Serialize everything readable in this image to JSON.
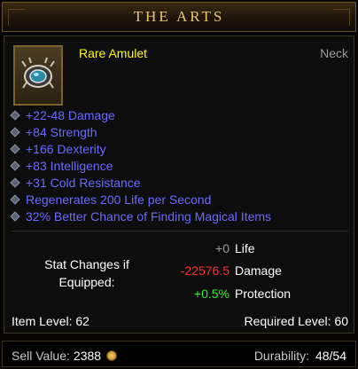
{
  "header": {
    "title": "THE ARTS"
  },
  "item": {
    "name": "Rare Amulet",
    "slot": "Neck",
    "icon": "amulet-icon",
    "name_color": "#ffff00"
  },
  "affixes": [
    "+22-48 Damage",
    "+84 Strength",
    "+166 Dexterity",
    "+83 Intelligence",
    "+31 Cold Resistance",
    "Regenerates 200 Life per Second",
    "32% Better Chance of Finding Magical Items"
  ],
  "stat_changes": {
    "title": "Stat Changes if Equipped:",
    "rows": [
      {
        "value": "+0",
        "name": "Life",
        "color": "#9a9a9a"
      },
      {
        "value": "-22576.5",
        "name": "Damage",
        "color": "#ff3030"
      },
      {
        "value": "+0.5%",
        "name": "Protection",
        "color": "#33ee33"
      }
    ]
  },
  "levels": {
    "item_level": "Item Level: 62",
    "required_level": "Required Level: 60"
  },
  "footer": {
    "sell_label": "Sell Value:",
    "sell_value": "2388",
    "durability_label": "Durability:",
    "durability_value": "48/54"
  }
}
